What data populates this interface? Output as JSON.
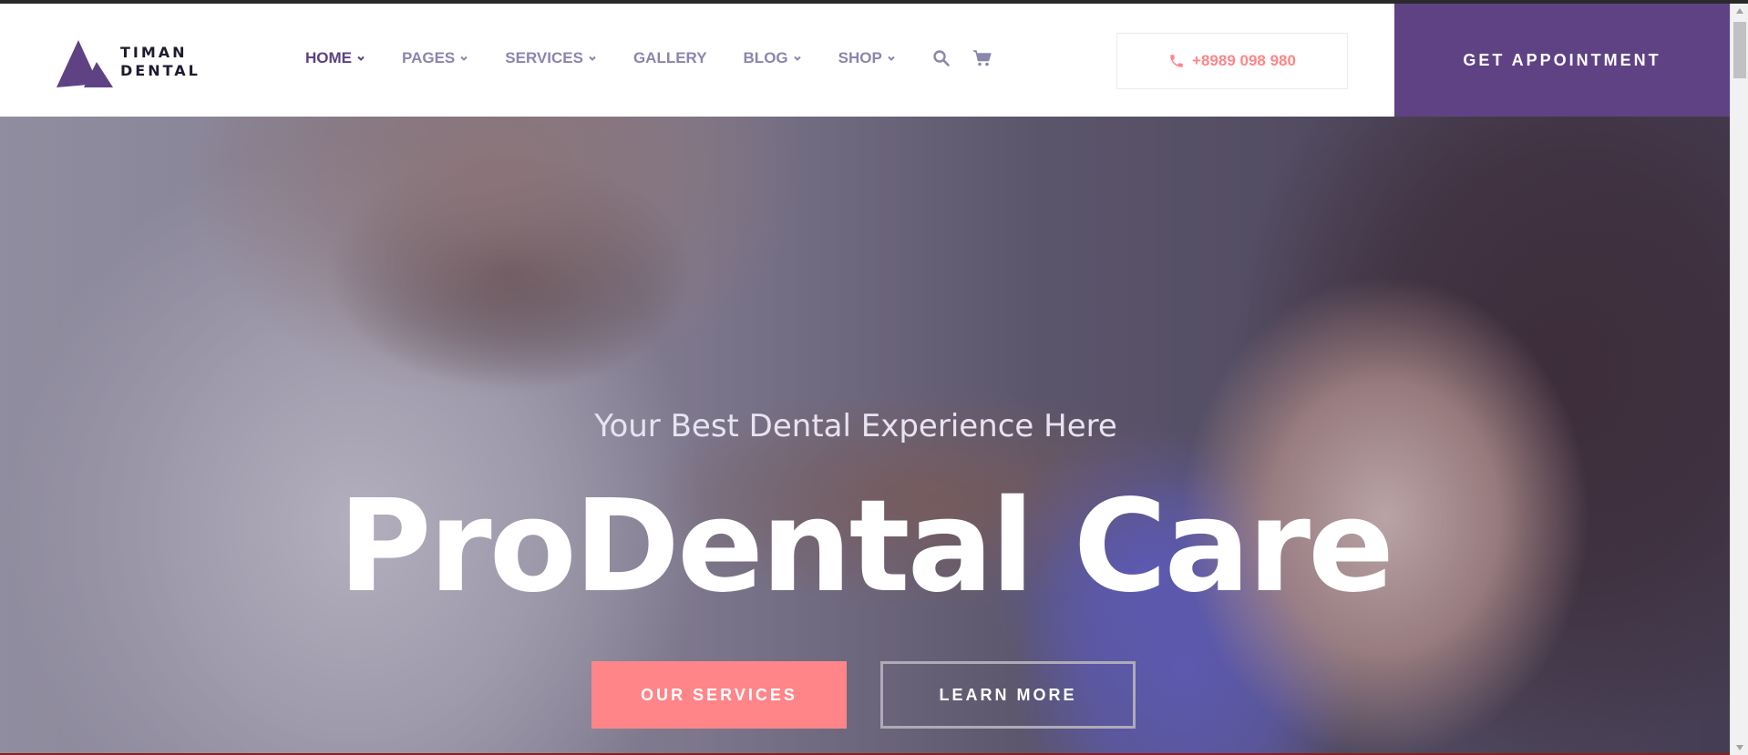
{
  "brand": {
    "line1": "TIMAN",
    "line2": "DENTAL",
    "color": "#5f4284"
  },
  "nav": {
    "items": [
      {
        "label": "HOME",
        "active": true,
        "dropdown": true
      },
      {
        "label": "PAGES",
        "active": false,
        "dropdown": true
      },
      {
        "label": "SERVICES",
        "active": false,
        "dropdown": true
      },
      {
        "label": "GALLERY",
        "active": false,
        "dropdown": false
      },
      {
        "label": "BLOG",
        "active": false,
        "dropdown": true
      },
      {
        "label": "SHOP",
        "active": false,
        "dropdown": true
      }
    ],
    "icons": [
      "search-icon",
      "cart-icon"
    ]
  },
  "contact": {
    "phone": "+8989 098 980",
    "icon": "phone-icon"
  },
  "cta": {
    "label": "GET APPOINTMENT"
  },
  "hero": {
    "subtitle": "Your Best Dental Experience Here",
    "title": "ProDental Care",
    "primary_button": "OUR SERVICES",
    "secondary_button": "LEARN MORE"
  },
  "colors": {
    "accent_pink": "#ff8588",
    "brand_purple": "#5f4284",
    "nav_text": "#8a86ad",
    "nav_active": "#5b4181"
  }
}
